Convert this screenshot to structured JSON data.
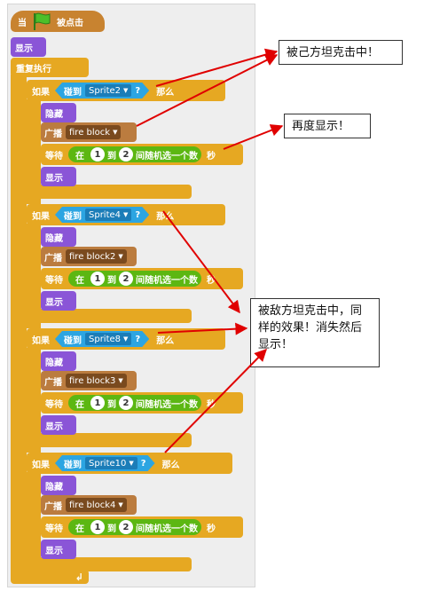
{
  "script": {
    "hat": {
      "prefix": "当",
      "suffix": "被点击"
    },
    "show_label": "显示",
    "forever_label": "重复执行",
    "groups": [
      {
        "if_label": "如果",
        "touching_label": "碰到",
        "sprite": "Sprite2",
        "q": "?",
        "then_label": "那么",
        "hide_label": "隐藏",
        "broadcast_label": "广播",
        "message": "fire block",
        "wait_label": "等待",
        "in_label": "在",
        "from": "1",
        "to_label": "到",
        "to": "2",
        "random_label": "间随机选一个数",
        "sec_label": "秒",
        "show_label": "显示"
      },
      {
        "if_label": "如果",
        "touching_label": "碰到",
        "sprite": "Sprite4",
        "q": "?",
        "then_label": "那么",
        "hide_label": "隐藏",
        "broadcast_label": "广播",
        "message": "fire block2",
        "wait_label": "等待",
        "in_label": "在",
        "from": "1",
        "to_label": "到",
        "to": "2",
        "random_label": "间随机选一个数",
        "sec_label": "秒",
        "show_label": "显示"
      },
      {
        "if_label": "如果",
        "touching_label": "碰到",
        "sprite": "Sprite8",
        "q": "?",
        "then_label": "那么",
        "hide_label": "隐藏",
        "broadcast_label": "广播",
        "message": "fire block3",
        "wait_label": "等待",
        "in_label": "在",
        "from": "1",
        "to_label": "到",
        "to": "2",
        "random_label": "间随机选一个数",
        "sec_label": "秒",
        "show_label": "显示"
      },
      {
        "if_label": "如果",
        "touching_label": "碰到",
        "sprite": "Sprite10",
        "q": "?",
        "then_label": "那么",
        "hide_label": "隐藏",
        "broadcast_label": "广播",
        "message": "fire block4",
        "wait_label": "等待",
        "in_label": "在",
        "from": "1",
        "to_label": "到",
        "to": "2",
        "random_label": "间随机选一个数",
        "sec_label": "秒",
        "show_label": "显示"
      }
    ]
  },
  "annotations": {
    "note1": "被己方坦克击中！",
    "note2": "再度显示！",
    "note3": "被敌方坦克击中，同样的效果！消失然后显示！"
  },
  "colors": {
    "event": "#c88330",
    "looks": "#8a55d7",
    "control": "#e6a822",
    "sound": "#bb7c3f",
    "operator": "#5cb712",
    "sensing": "#2ca5e2",
    "arrow": "#e00000"
  },
  "icons": {
    "green_flag": "flag-icon",
    "loop_arrow": "loop-arrow-icon"
  }
}
